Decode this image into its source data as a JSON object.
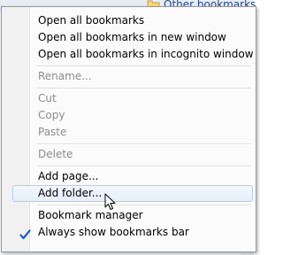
{
  "bookmarks_bar": {
    "other_bookmarks_label": "Other bookmarks",
    "folder_icon": "folder-icon"
  },
  "menu": {
    "items": [
      {
        "label": "Open all bookmarks",
        "enabled": true
      },
      {
        "label": "Open all bookmarks in new window",
        "enabled": true
      },
      {
        "label": "Open all bookmarks in incognito window",
        "enabled": true
      },
      {
        "label": "Rename...",
        "enabled": false
      },
      {
        "label": "Cut",
        "enabled": false
      },
      {
        "label": "Copy",
        "enabled": false
      },
      {
        "label": "Paste",
        "enabled": false
      },
      {
        "label": "Delete",
        "enabled": false
      },
      {
        "label": "Add page...",
        "enabled": true
      },
      {
        "label": "Add folder...",
        "enabled": true,
        "hovered": true
      },
      {
        "label": "Bookmark manager",
        "enabled": true
      },
      {
        "label": "Always show bookmarks bar",
        "enabled": true,
        "checked": true
      }
    ]
  },
  "colors": {
    "hover_border": "#aecff7",
    "disabled_text": "#8d8d8d",
    "check_color": "#1a5fc8"
  }
}
